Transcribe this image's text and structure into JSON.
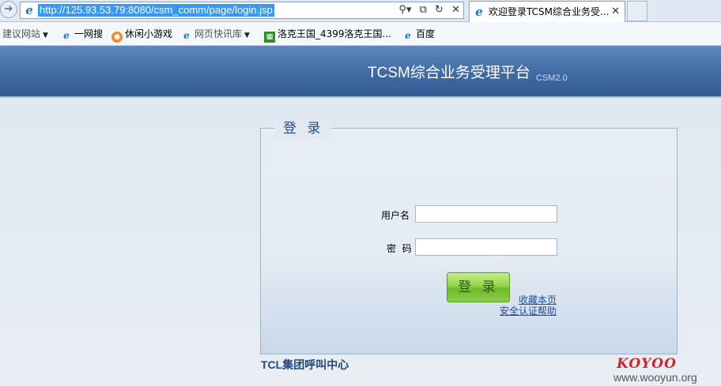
{
  "browser": {
    "url": "http://125.93.53.79:8080/csm_comm/page/login.jsp",
    "tab_title": "欢迎登录TCSM综合业务受...",
    "favorites": [
      {
        "label": "建议网站",
        "icon": "none",
        "dropdown": true,
        "style": "grey"
      },
      {
        "label": "一网搜",
        "icon": "ie-icon",
        "dropdown": false
      },
      {
        "label": "休闲小游戏",
        "icon": "game-icon",
        "dropdown": false
      },
      {
        "label": "网页快讯库",
        "icon": "ie-icon",
        "dropdown": true,
        "style": "grey"
      },
      {
        "label": "洛克王国_4399洛克王国...",
        "icon": "grid-icon",
        "dropdown": false
      },
      {
        "label": "百度",
        "icon": "ie-icon",
        "dropdown": false
      }
    ]
  },
  "header": {
    "title": "TCSM综合业务受理平台",
    "version": "CSM2.0"
  },
  "login": {
    "legend": "登 录",
    "username_label": "用户名",
    "username_value": "",
    "password_label": "密  码",
    "password_value": "",
    "submit_label": "登 录",
    "bookmark_link": "收藏本页",
    "help_link": "安全认证帮助"
  },
  "footer": {
    "org": "TCL集团呼叫中心"
  },
  "watermark": {
    "logo": "KOYOO",
    "site": "www.wooyun.org"
  },
  "colors": {
    "header_band": "#3f6aa3",
    "link": "#1e4fa0",
    "button_green": "#8ecd4b",
    "watermark_red": "#d4242a"
  }
}
